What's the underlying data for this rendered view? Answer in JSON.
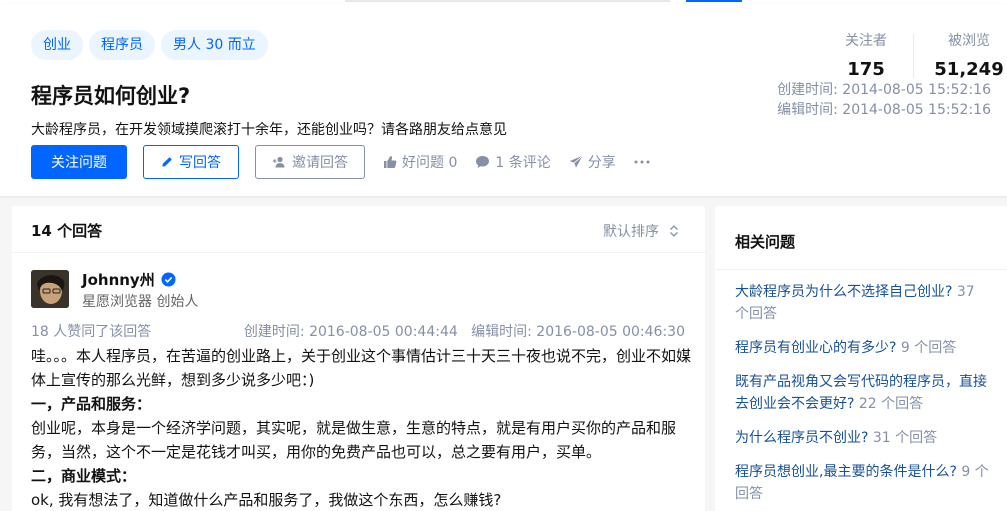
{
  "question": {
    "tags": [
      "创业",
      "程序员",
      "男人 30 而立"
    ],
    "title": "程序员如何创业?",
    "detail": "大龄程序员，在开发领域摸爬滚打十余年，还能创业吗？请各路朋友给点意见",
    "actions": {
      "follow": "关注问题",
      "write": "写回答",
      "invite": "邀请回答",
      "like": "好问题 0",
      "comments": "1 条评论",
      "share": "分享"
    },
    "stats": {
      "followers_label": "关注者",
      "followers": "175",
      "views_label": "被浏览",
      "views": "51,249"
    },
    "created": "创建时间:  2014-08-05 15:52:16",
    "edited": "编辑时间:  2014-08-05 15:52:16"
  },
  "answers": {
    "header": "14 个回答",
    "sort_label": "默认排序",
    "first": {
      "author": "Johnny州",
      "bio": "星愿浏览器 创始人",
      "votes": "18 人赞同了该回答",
      "created": "创建时间: 2016-08-05 00:44:44",
      "edited": "编辑时间: 2016-08-05 00:46:30",
      "p1": "哇。。。本人程序员，在苦逼的创业路上，关于创业这个事情估计三十天三十夜也说不完，创业不如媒体上宣传的那么光鲜，想到多少说多少吧：)",
      "h1": "一，产品和服务：",
      "p2": "创业呢，本身是一个经济学问题，其实呢，就是做生意，生意的特点，就是有用户买你的产品和服务，当然，这个不一定是花钱才叫买，用你的免费产品也可以，总之要有用户，买单。",
      "h2": "二，商业模式：",
      "p3": "ok, 我有想法了，知道做什么产品和服务了，我做这个东西，怎么赚钱?"
    }
  },
  "related": {
    "header": "相关问题",
    "items": [
      {
        "title": "大龄程序员为什么不选择自己创业?",
        "count": "37 个回答"
      },
      {
        "title": "程序员有创业心的有多少?",
        "count": "9 个回答"
      },
      {
        "title": "既有产品视角又会写代码的程序员，直接去创业会不会更好?",
        "count": "22 个回答"
      },
      {
        "title": "为什么程序员不创业?",
        "count": "31 个回答"
      },
      {
        "title": "程序员想创业,最主要的条件是什么?",
        "count": "9 个回答"
      }
    ]
  },
  "colors": {
    "brand": "#0066ff",
    "link": "#175199",
    "muted": "#8590a6"
  }
}
